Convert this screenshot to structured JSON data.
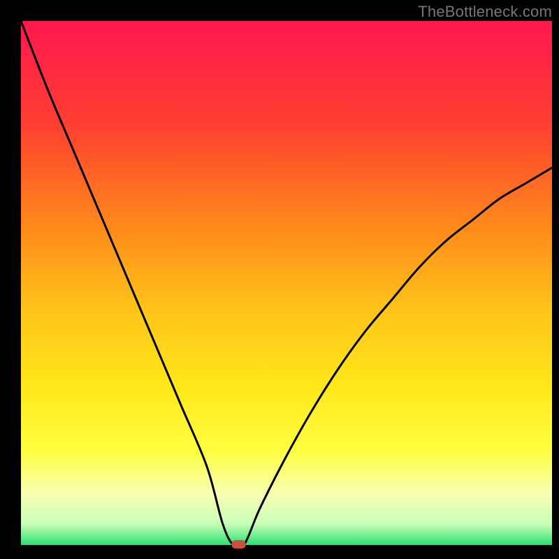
{
  "watermark": "TheBottleneck.com",
  "chart_data": {
    "type": "line",
    "title": "",
    "xlabel": "",
    "ylabel": "",
    "xlim": [
      0,
      100
    ],
    "ylim": [
      0,
      100
    ],
    "x": [
      0,
      5,
      10,
      15,
      20,
      25,
      30,
      35,
      38,
      40,
      42,
      45,
      50,
      55,
      60,
      65,
      70,
      75,
      80,
      85,
      90,
      95,
      100
    ],
    "values": [
      100,
      87,
      75,
      63,
      51,
      39,
      27,
      15,
      4,
      0,
      0,
      7,
      17,
      26,
      34,
      41,
      47,
      53,
      58,
      62,
      66,
      69,
      72
    ],
    "note": "V-shaped bottleneck mismatch curve; y=0 is optimal (green), y=100 is worst (red). Minimum near x≈40.",
    "gradient_stops": [
      {
        "pos": 0.0,
        "color": "#ff1850"
      },
      {
        "pos": 0.2,
        "color": "#ff4030"
      },
      {
        "pos": 0.4,
        "color": "#ff8c1a"
      },
      {
        "pos": 0.55,
        "color": "#ffc41a"
      },
      {
        "pos": 0.7,
        "color": "#ffe81a"
      },
      {
        "pos": 0.82,
        "color": "#ffff40"
      },
      {
        "pos": 0.9,
        "color": "#f8ffb0"
      },
      {
        "pos": 0.96,
        "color": "#c8ffb8"
      },
      {
        "pos": 1.0,
        "color": "#28e070"
      }
    ],
    "marker": {
      "x": 41,
      "y": 0,
      "color": "#cc5040"
    }
  },
  "geometry": {
    "inner_left": 30,
    "inner_top": 30,
    "inner_right": 790,
    "inner_bottom": 780
  }
}
